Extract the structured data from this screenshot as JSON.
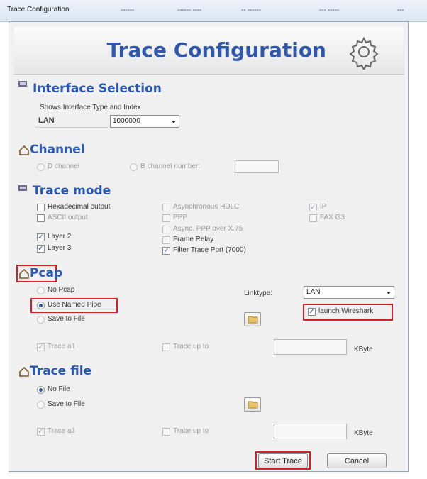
{
  "window": {
    "title": "Trace Configuration"
  },
  "banner": {
    "title": "Trace Configuration",
    "icon": "gear-icon"
  },
  "interface_selection": {
    "title": "Interface Selection",
    "subtitle": "Shows Interface Type and Index",
    "type_value": "LAN",
    "index_value": "1000000"
  },
  "channel": {
    "title": "Channel",
    "d_channel_label": "D channel",
    "b_channel_label": "B channel number:",
    "b_channel_value": ""
  },
  "trace_mode": {
    "title": "Trace mode",
    "options": {
      "hex": {
        "label": "Hexadecimal output",
        "checked": false
      },
      "ascii": {
        "label": "ASCII output",
        "checked": false
      },
      "layer2": {
        "label": "Layer 2",
        "checked": true
      },
      "layer3": {
        "label": "Layer 3",
        "checked": true
      },
      "async_hdlc": {
        "label": "Asynchronous HDLC",
        "checked": false
      },
      "ppp": {
        "label": "PPP",
        "checked": false
      },
      "async_ppp": {
        "label": "Async. PPP over X.75",
        "checked": false
      },
      "frame_relay": {
        "label": "Frame Relay",
        "checked": false
      },
      "filter_port": {
        "label": "Filter Trace Port (7000)",
        "checked": true
      },
      "ip": {
        "label": "IP",
        "checked": true
      },
      "fax": {
        "label": "FAX G3",
        "checked": false
      }
    }
  },
  "pcap": {
    "title": "Pcap",
    "no_pcap_label": "No Pcap",
    "named_pipe_label": "Use Named Pipe",
    "save_file_label": "Save to File",
    "selected": "named_pipe",
    "linktype_label": "Linktype:",
    "linktype_value": "LAN",
    "launch_label": "launch Wireshark",
    "launch_checked": true,
    "trace_all_label": "Trace all",
    "trace_up_label": "Trace up to",
    "trace_up_value": "",
    "kbyte_label": "KByte"
  },
  "trace_file": {
    "title": "Trace file",
    "no_file_label": "No File",
    "save_file_label": "Save to File",
    "selected": "no_file",
    "trace_all_label": "Trace all",
    "trace_up_label": "Trace up to",
    "trace_up_value": "",
    "kbyte_label": "KByte"
  },
  "buttons": {
    "start_label": "Start Trace",
    "cancel_label": "Cancel"
  },
  "colors": {
    "section_title": "#2a58b5",
    "banner_title": "#2f58ad",
    "highlight": "#d81f26"
  }
}
